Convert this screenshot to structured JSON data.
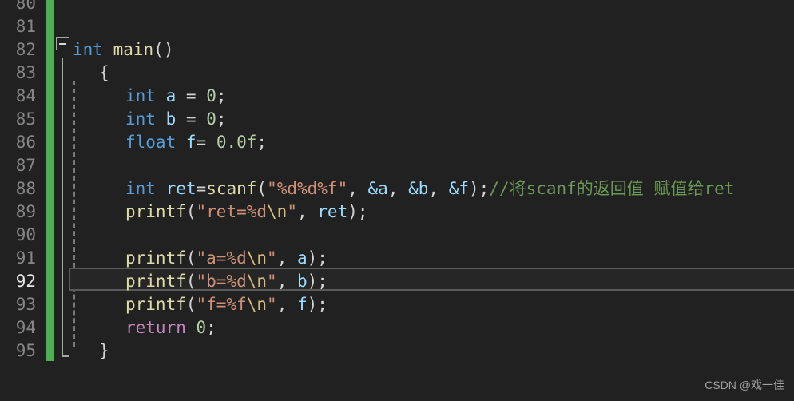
{
  "editor": {
    "language": "c",
    "background_color": "#212121",
    "change_bar_color": "#4caf50",
    "active_line_number": "92",
    "fold_marker": "minus",
    "line_numbers": [
      "80",
      "81",
      "82",
      "83",
      "84",
      "85",
      "86",
      "87",
      "88",
      "89",
      "90",
      "91",
      "92",
      "93",
      "94",
      "95"
    ],
    "lines": [
      {
        "number": "80",
        "tokens": []
      },
      {
        "number": "81",
        "tokens": []
      },
      {
        "number": "82",
        "tokens": [
          {
            "t": "int",
            "c": "kw"
          },
          {
            "t": " ",
            "c": "punct"
          },
          {
            "t": "main",
            "c": "fn"
          },
          {
            "t": "()",
            "c": "punct"
          }
        ]
      },
      {
        "number": "83",
        "tokens": [
          {
            "t": "{",
            "c": "punct"
          }
        ]
      },
      {
        "number": "84",
        "tokens": [
          {
            "t": "int",
            "c": "kw"
          },
          {
            "t": " ",
            "c": "punct"
          },
          {
            "t": "a",
            "c": "var"
          },
          {
            "t": " = ",
            "c": "punct"
          },
          {
            "t": "0",
            "c": "num"
          },
          {
            "t": ";",
            "c": "punct"
          }
        ]
      },
      {
        "number": "85",
        "tokens": [
          {
            "t": "int",
            "c": "kw"
          },
          {
            "t": " ",
            "c": "punct"
          },
          {
            "t": "b",
            "c": "var"
          },
          {
            "t": " = ",
            "c": "punct"
          },
          {
            "t": "0",
            "c": "num"
          },
          {
            "t": ";",
            "c": "punct"
          }
        ]
      },
      {
        "number": "86",
        "tokens": [
          {
            "t": "float",
            "c": "kw"
          },
          {
            "t": " ",
            "c": "punct"
          },
          {
            "t": "f",
            "c": "var"
          },
          {
            "t": "= ",
            "c": "punct"
          },
          {
            "t": "0.0f",
            "c": "num"
          },
          {
            "t": ";",
            "c": "punct"
          }
        ]
      },
      {
        "number": "87",
        "tokens": []
      },
      {
        "number": "88",
        "tokens": [
          {
            "t": "int",
            "c": "kw"
          },
          {
            "t": " ",
            "c": "punct"
          },
          {
            "t": "ret",
            "c": "var"
          },
          {
            "t": "=",
            "c": "punct"
          },
          {
            "t": "scanf",
            "c": "fn"
          },
          {
            "t": "(",
            "c": "punct"
          },
          {
            "t": "\"%d%d%f\"",
            "c": "str"
          },
          {
            "t": ", ",
            "c": "punct"
          },
          {
            "t": "&a",
            "c": "var"
          },
          {
            "t": ", ",
            "c": "punct"
          },
          {
            "t": "&b",
            "c": "var"
          },
          {
            "t": ", ",
            "c": "punct"
          },
          {
            "t": "&f",
            "c": "var"
          },
          {
            "t": ");",
            "c": "punct"
          },
          {
            "t": "//将scanf的返回值 赋值给ret",
            "c": "cmt"
          }
        ]
      },
      {
        "number": "89",
        "tokens": [
          {
            "t": "printf",
            "c": "fn"
          },
          {
            "t": "(",
            "c": "punct"
          },
          {
            "t": "\"ret=%d",
            "c": "str"
          },
          {
            "t": "\\n",
            "c": "esc"
          },
          {
            "t": "\"",
            "c": "str"
          },
          {
            "t": ", ",
            "c": "punct"
          },
          {
            "t": "ret",
            "c": "var"
          },
          {
            "t": ");",
            "c": "punct"
          }
        ]
      },
      {
        "number": "90",
        "tokens": []
      },
      {
        "number": "91",
        "tokens": [
          {
            "t": "printf",
            "c": "fn"
          },
          {
            "t": "(",
            "c": "punct"
          },
          {
            "t": "\"a=%d",
            "c": "str"
          },
          {
            "t": "\\n",
            "c": "esc"
          },
          {
            "t": "\"",
            "c": "str"
          },
          {
            "t": ", ",
            "c": "punct"
          },
          {
            "t": "a",
            "c": "var"
          },
          {
            "t": ");",
            "c": "punct"
          }
        ]
      },
      {
        "number": "92",
        "active": true,
        "tokens": [
          {
            "t": "printf",
            "c": "fn"
          },
          {
            "t": "(",
            "c": "punct"
          },
          {
            "t": "\"b=%d",
            "c": "str"
          },
          {
            "t": "\\n",
            "c": "esc"
          },
          {
            "t": "\"",
            "c": "str"
          },
          {
            "t": ", ",
            "c": "punct"
          },
          {
            "t": "b",
            "c": "var"
          },
          {
            "t": ");",
            "c": "punct"
          }
        ]
      },
      {
        "number": "93",
        "tokens": [
          {
            "t": "printf",
            "c": "fn"
          },
          {
            "t": "(",
            "c": "punct"
          },
          {
            "t": "\"f=%f",
            "c": "str"
          },
          {
            "t": "\\n",
            "c": "esc"
          },
          {
            "t": "\"",
            "c": "str"
          },
          {
            "t": ", ",
            "c": "punct"
          },
          {
            "t": "f",
            "c": "var"
          },
          {
            "t": ");",
            "c": "punct"
          }
        ]
      },
      {
        "number": "94",
        "tokens": [
          {
            "t": "return",
            "c": "kwctl"
          },
          {
            "t": " ",
            "c": "punct"
          },
          {
            "t": "0",
            "c": "num"
          },
          {
            "t": ";",
            "c": "punct"
          }
        ]
      },
      {
        "number": "95",
        "tokens": [
          {
            "t": "}",
            "c": "punct"
          }
        ]
      }
    ],
    "indents": {
      "80": 0,
      "81": 0,
      "82": 0,
      "83": 1,
      "84": 2,
      "85": 2,
      "86": 2,
      "87": 0,
      "88": 2,
      "89": 2,
      "90": 0,
      "91": 2,
      "92": 2,
      "93": 2,
      "94": 2,
      "95": 1
    }
  },
  "watermark": {
    "text": "CSDN @戏一佳"
  }
}
